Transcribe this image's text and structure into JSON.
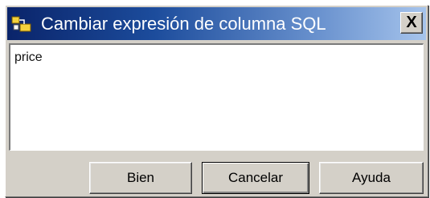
{
  "window": {
    "title": "Cambiar expresión de columna SQL",
    "close_label": "X",
    "title_icon": "window-app-icon"
  },
  "editor": {
    "value": "price"
  },
  "buttons": {
    "ok_label": "Bien",
    "cancel_label": "Cancelar",
    "help_label": "Ayuda"
  },
  "colors": {
    "titlebar_start": "#0a246a",
    "titlebar_end": "#a6c4ec",
    "face": "#d4d0c8"
  }
}
